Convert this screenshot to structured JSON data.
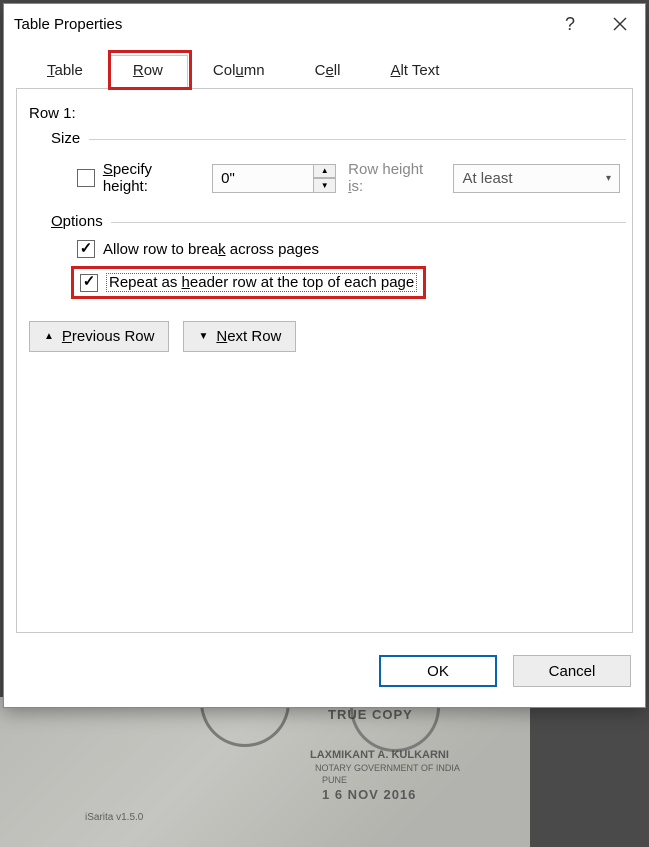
{
  "window": {
    "title": "Table Properties",
    "help": "?",
    "close": "✕"
  },
  "tabs": {
    "table": {
      "pre": "",
      "u": "T",
      "post": "able"
    },
    "row": {
      "pre": "",
      "u": "R",
      "post": "ow"
    },
    "column": {
      "pre": "Col",
      "u": "u",
      "post": "mn"
    },
    "cell": {
      "pre": "C",
      "u": "e",
      "post": "ll"
    },
    "alt": {
      "pre": "",
      "u": "A",
      "post": "lt Text"
    }
  },
  "row_label": "Row 1:",
  "size": {
    "title": "Size",
    "specify_pre": "",
    "specify_u": "S",
    "specify_post": "pecify height:",
    "value": "0\"",
    "hint_pre": "Row height ",
    "hint_u": "i",
    "hint_post": "s:",
    "select_value": "At least"
  },
  "options": {
    "title_pre": "",
    "title_u": "O",
    "title_post": "ptions",
    "break_pre": "Allow row to brea",
    "break_u": "k",
    "break_post": " across pages",
    "repeat_pre": "Repeat as ",
    "repeat_u": "h",
    "repeat_post": "eader row at the top of each page"
  },
  "nav": {
    "prev_pre": "",
    "prev_u": "P",
    "prev_post": "revious Row",
    "next_pre": "",
    "next_u": "N",
    "next_post": "ext Row"
  },
  "footer": {
    "ok": "OK",
    "cancel": "Cancel"
  },
  "paper": {
    "truecopy": "TRUE COPY",
    "name": "LAXMIKANT A. KULKARNI",
    "notary": "NOTARY GOVERNMENT OF INDIA",
    "pune": "PUNE",
    "date": "1 6 NOV 2016",
    "ver": "iSarita v1.5.0"
  }
}
